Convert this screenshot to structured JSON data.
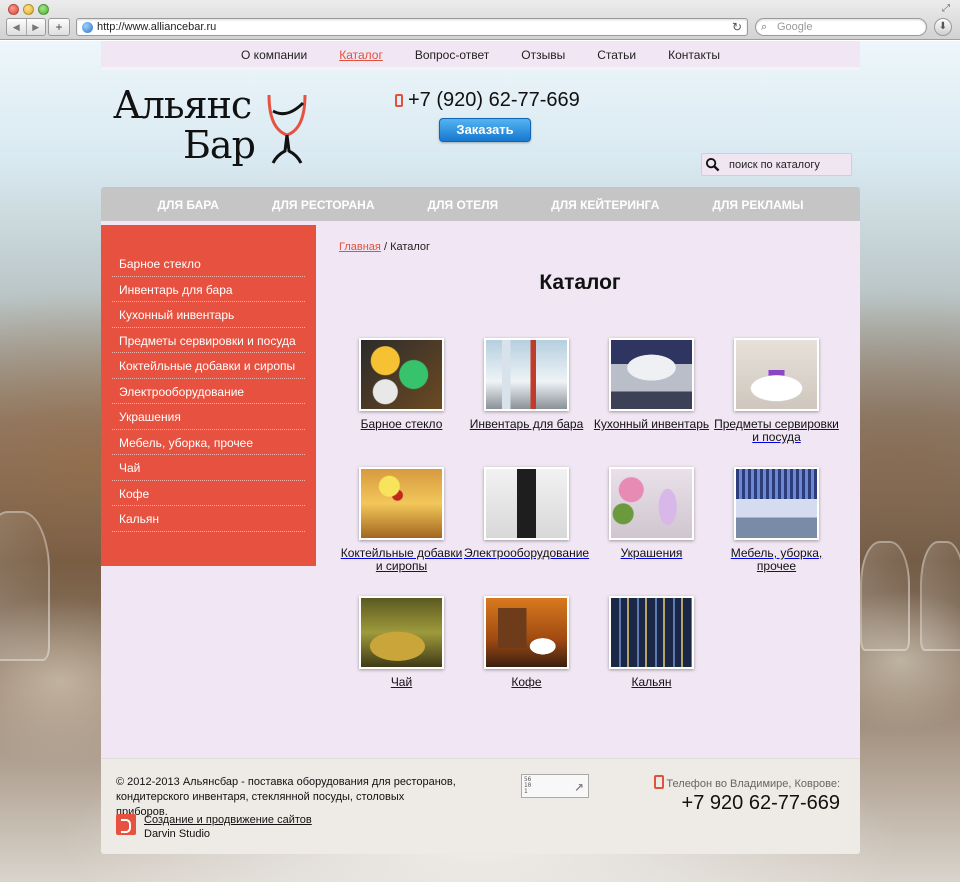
{
  "browser": {
    "url": "http://www.alliancebar.ru",
    "search_placeholder": "Google"
  },
  "topnav": [
    {
      "label": "О компании"
    },
    {
      "label": "Каталог",
      "active": true
    },
    {
      "label": "Вопрос-ответ"
    },
    {
      "label": "Отзывы"
    },
    {
      "label": "Статьи"
    },
    {
      "label": "Контакты"
    }
  ],
  "header": {
    "logo_line1": "Альянс",
    "logo_line2": "Бар",
    "phone": "+7 (920) 62-77-669",
    "order_button": "Заказать",
    "search_placeholder": "поиск по каталогу"
  },
  "catbar": [
    "ДЛЯ БАРА",
    "ДЛЯ РЕСТОРАНА",
    "ДЛЯ ОТЕЛЯ",
    "ДЛЯ КЕЙТЕРИНГА",
    "ДЛЯ РЕКЛАМЫ"
  ],
  "sidebar": [
    "Барное стекло",
    "Инвентарь для бара",
    "Кухонный инвентарь",
    "Предметы сервировки и посуда",
    "Коктейльные добавки и сиропы",
    "Электрооборудование",
    "Украшения",
    "Мебель, уборка, прочее",
    "Чай",
    "Кофе",
    "Кальян"
  ],
  "breadcrumb": {
    "home": "Главная",
    "separator": "/",
    "current": "Каталог"
  },
  "page_title": "Каталог",
  "catalog": [
    {
      "caption": "Барное стекло",
      "icon": "cocktail-glasses-photo"
    },
    {
      "caption": "Инвентарь для бара",
      "icon": "bar-tools-photo"
    },
    {
      "caption": "Кухонный инвентарь",
      "icon": "cookware-photo"
    },
    {
      "caption": "Предметы сервировки и посуда",
      "icon": "tableware-photo"
    },
    {
      "caption": "Коктейльные добавки и сиропы",
      "icon": "cocktail-photo"
    },
    {
      "caption": "Электрооборудование",
      "icon": "blender-photo"
    },
    {
      "caption": "Украшения",
      "icon": "decor-photo"
    },
    {
      "caption": "Мебель, уборка, прочее",
      "icon": "furniture-photo"
    },
    {
      "caption": "Чай",
      "icon": "tea-photo"
    },
    {
      "caption": "Кофе",
      "icon": "coffee-photo"
    },
    {
      "caption": "Кальян",
      "icon": "hookah-photo"
    }
  ],
  "footer": {
    "copyright": "© 2012-2013 Альянсбар - поставка оборудования для ресторанов, кондитерского инвентаря, стеклянной посуды, столовых приборов.",
    "studio_link": "Создание и продвижение сайтов",
    "studio_name": "Darvin Studio",
    "counter_text": "56\n10\n1",
    "phone_label": "Телефон во Владимире, Коврове:",
    "phone": "+7 920 62-77-669"
  },
  "colors": {
    "accent": "#e75240",
    "panel": "#f1e6f3",
    "catbar": "#c5c5c5",
    "order_button": "#2a8ae0"
  }
}
